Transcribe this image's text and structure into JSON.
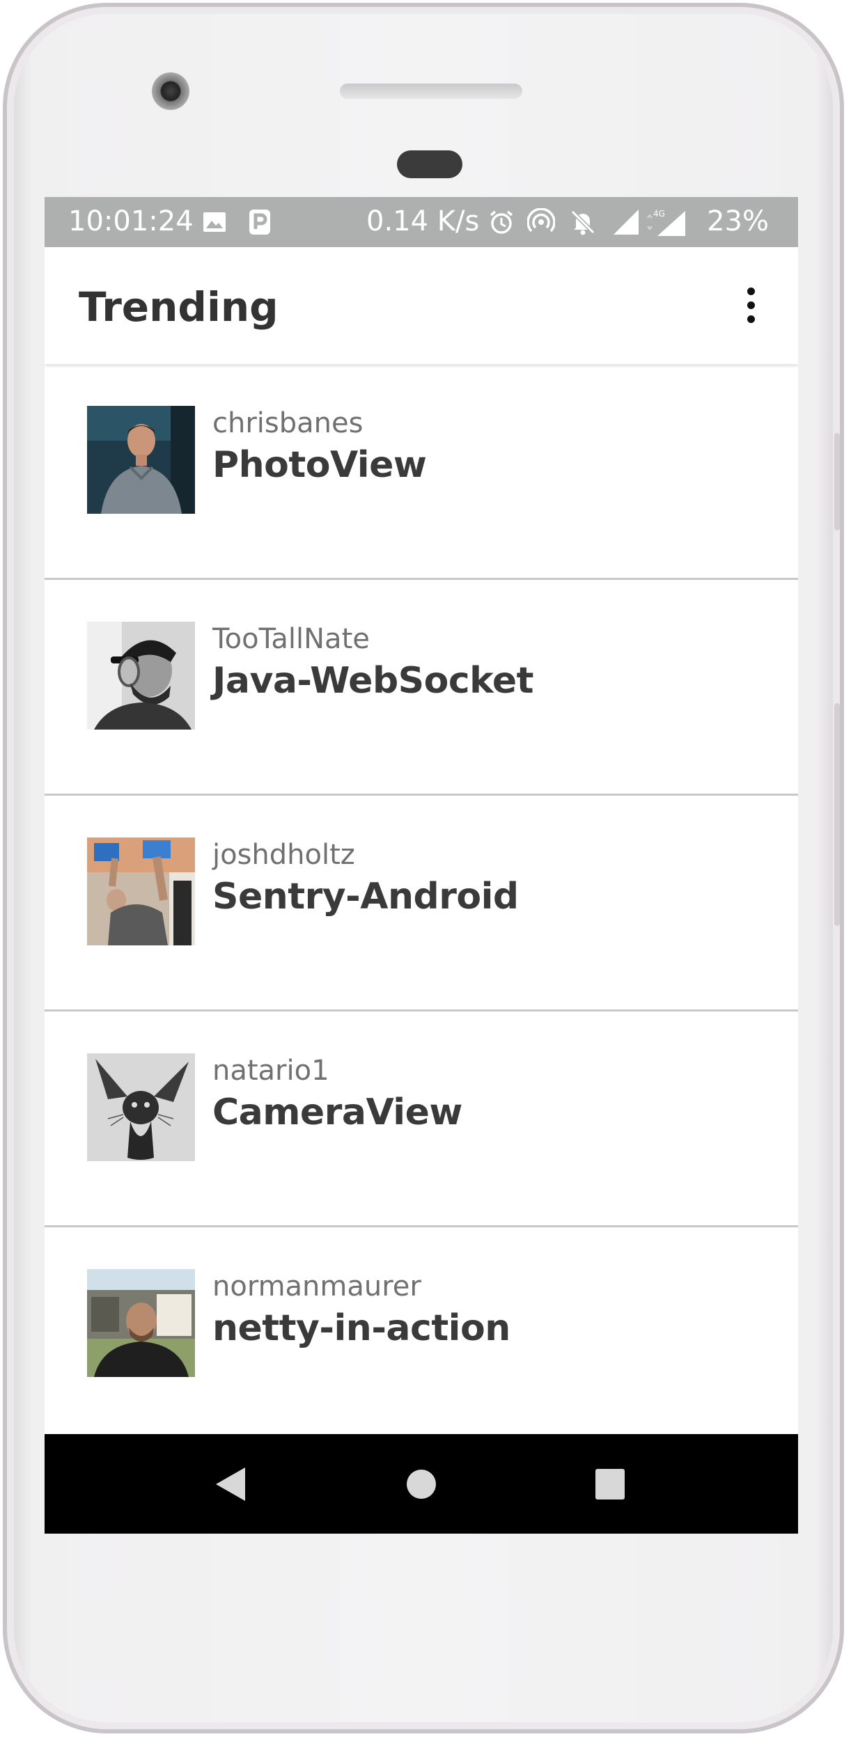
{
  "status_bar": {
    "time": "10:01:24",
    "network_speed": "0.14 K/s",
    "battery": "23%",
    "icons": [
      "image-icon",
      "parking-p-icon",
      "alarm-icon",
      "hotspot-icon",
      "notifications-off-icon",
      "signal-icon",
      "signal-4g-icon"
    ]
  },
  "app_bar": {
    "title": "Trending",
    "menu_icon": "overflow-menu-icon"
  },
  "repositories": [
    {
      "owner": "chrisbanes",
      "name": "PhotoView"
    },
    {
      "owner": "TooTallNate",
      "name": "Java-WebSocket"
    },
    {
      "owner": "joshdholtz",
      "name": "Sentry-Android"
    },
    {
      "owner": "natario1",
      "name": "CameraView"
    },
    {
      "owner": "normanmaurer",
      "name": "netty-in-action"
    }
  ],
  "nav_bar": {
    "buttons": [
      "back-icon",
      "home-icon",
      "recents-icon"
    ]
  },
  "colors": {
    "status_bar": "#aeb0b0",
    "app_bar": "#ffffff",
    "nav_bar": "#000000",
    "repo_name": "#3a3a3a",
    "owner_name": "#707070"
  }
}
